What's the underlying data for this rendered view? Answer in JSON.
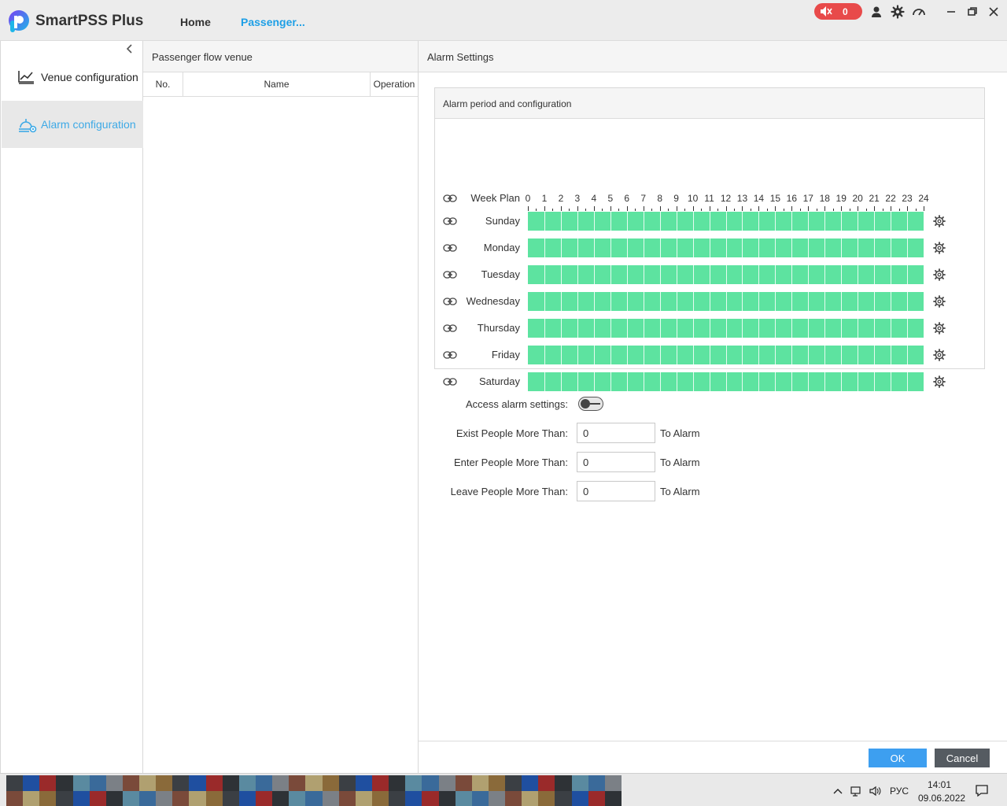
{
  "app": {
    "title": "SmartPSS Plus",
    "nav": [
      "Home",
      "Passenger..."
    ],
    "alarm_count": "0",
    "colors": {
      "accent": "#1e9fe6",
      "alarm_badge": "#e84a4a",
      "schedule_bar": "#5de3a0",
      "ok_button": "#3d9ff0",
      "cancel_button": "#555b61"
    }
  },
  "sidebar": {
    "items": [
      {
        "label": "Venue configuration",
        "icon": "venue-chart-icon",
        "active": false
      },
      {
        "label": "Alarm configuration",
        "icon": "alarm-config-icon",
        "active": true
      }
    ]
  },
  "venue_panel": {
    "title": "Passenger flow venue",
    "columns": [
      "No.",
      "Name",
      "Operation"
    ],
    "rows": []
  },
  "alarm_panel": {
    "title": "Alarm Settings",
    "schedule": {
      "title": "Alarm period and configuration",
      "week_plan_label": "Week Plan",
      "hours": [
        "0",
        "1",
        "2",
        "3",
        "4",
        "5",
        "6",
        "7",
        "8",
        "9",
        "10",
        "11",
        "12",
        "13",
        "14",
        "15",
        "16",
        "17",
        "18",
        "19",
        "20",
        "21",
        "22",
        "23",
        "24"
      ],
      "days": [
        {
          "name": "Sunday",
          "armed_fraction": 1.0
        },
        {
          "name": "Monday",
          "armed_fraction": 1.0
        },
        {
          "name": "Tuesday",
          "armed_fraction": 1.0
        },
        {
          "name": "Wednesday",
          "armed_fraction": 1.0
        },
        {
          "name": "Thursday",
          "armed_fraction": 1.0
        },
        {
          "name": "Friday",
          "armed_fraction": 1.0
        },
        {
          "name": "Saturday",
          "armed_fraction": 1.0
        }
      ]
    },
    "form": {
      "access_alarm_label": "Access alarm settings:",
      "access_alarm_enabled": false,
      "fields": [
        {
          "label": "Exist People More Than:",
          "value": "0",
          "suffix": "To Alarm"
        },
        {
          "label": "Enter People More Than:",
          "value": "0",
          "suffix": "To Alarm"
        },
        {
          "label": "Leave People More Than:",
          "value": "0",
          "suffix": "To Alarm"
        }
      ]
    },
    "buttons": {
      "ok": "OK",
      "cancel": "Cancel"
    }
  },
  "taskbar": {
    "language": "РУС",
    "time": "14:01",
    "date": "09.06.2022"
  }
}
